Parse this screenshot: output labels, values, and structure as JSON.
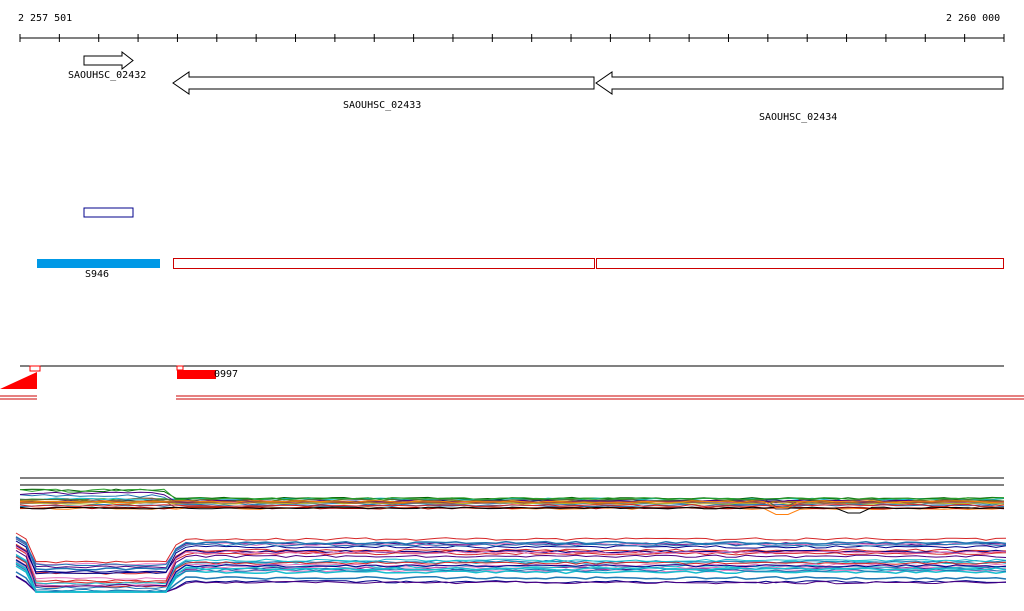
{
  "ruler": {
    "start_label": "2 257 501",
    "end_label": "2 260 000"
  },
  "genes": [
    {
      "id": "gene-02432",
      "label": "SAOUHSC_02432",
      "strand": "+"
    },
    {
      "id": "gene-02433",
      "label": "SAOUHSC_02433",
      "strand": "-"
    },
    {
      "id": "gene-02434",
      "label": "SAOUHSC_02434",
      "strand": "-"
    }
  ],
  "features": {
    "srna_label": "S946",
    "peak_label": "0997"
  },
  "colors": {
    "gene_outline": "#000000",
    "blue_outline": "#00008b",
    "blue_fill": "#0099e6",
    "red": "#ff0000",
    "dark_red": "#cc0000"
  }
}
